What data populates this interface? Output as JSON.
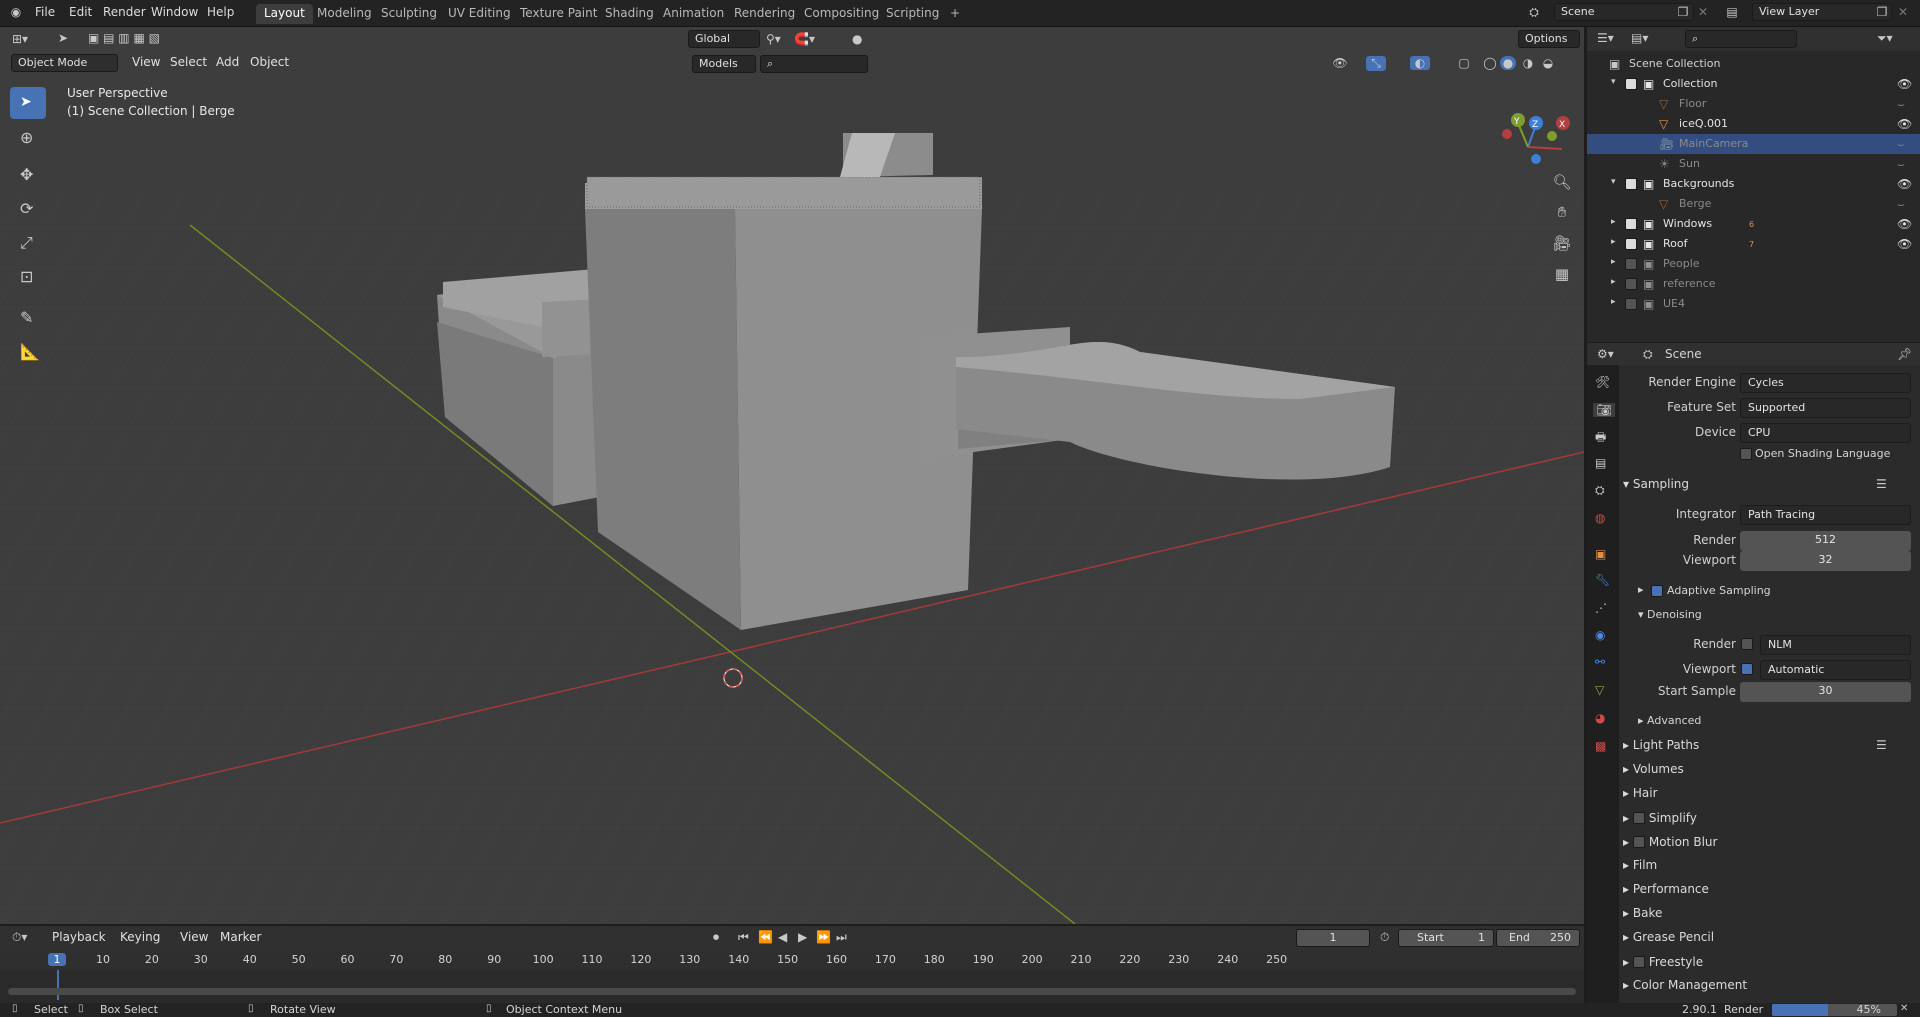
{
  "menubar": {
    "items": [
      "File",
      "Edit",
      "Render",
      "Window",
      "Help"
    ],
    "workspaces": [
      "Layout",
      "Modeling",
      "Sculpting",
      "UV Editing",
      "Texture Paint",
      "Shading",
      "Animation",
      "Rendering",
      "Compositing",
      "Scripting"
    ],
    "active_workspace": "Layout",
    "add_tab": "+",
    "scene_name": "Scene",
    "view_layer_name": "View Layer"
  },
  "viewport_header": {
    "mode": "Object Mode",
    "menus": [
      "View",
      "Select",
      "Add",
      "Object"
    ],
    "orientation": "Global",
    "collection_filter": "Models",
    "options": "Options"
  },
  "viewport": {
    "perspective_label": "User Perspective",
    "context_label": "(1) Scene Collection | Berge",
    "gizmo_axes": [
      "X",
      "Y",
      "Z"
    ]
  },
  "outliner": {
    "root": "Scene Collection",
    "rows": [
      {
        "name": "Collection",
        "type": "collection",
        "checked": true,
        "visible": true,
        "depth": 1
      },
      {
        "name": "Floor",
        "type": "object",
        "dim": true,
        "visible": false,
        "depth": 2
      },
      {
        "name": "iceQ.001",
        "type": "object",
        "dim": false,
        "visible": true,
        "depth": 2
      },
      {
        "name": "MainCamera",
        "type": "camera",
        "dim": true,
        "visible": false,
        "selected": true,
        "depth": 2
      },
      {
        "name": "Sun",
        "type": "light",
        "dim": true,
        "visible": false,
        "depth": 2
      },
      {
        "name": "Backgrounds",
        "type": "collection",
        "checked": true,
        "visible": true,
        "depth": 1
      },
      {
        "name": "Berge",
        "type": "object",
        "dim": true,
        "visible": false,
        "depth": 2
      },
      {
        "name": "Windows",
        "type": "collection",
        "checked": true,
        "visible": true,
        "depth": 1,
        "badge": "6"
      },
      {
        "name": "Roof",
        "type": "collection",
        "checked": true,
        "visible": true,
        "depth": 1,
        "badge": "7"
      },
      {
        "name": "People",
        "type": "collection",
        "checked": false,
        "dim": true,
        "depth": 1
      },
      {
        "name": "reference",
        "type": "collection",
        "checked": false,
        "dim": true,
        "depth": 1
      },
      {
        "name": "UE4",
        "type": "collection",
        "checked": false,
        "dim": true,
        "depth": 1
      }
    ]
  },
  "properties": {
    "context": "Scene",
    "render_engine_label": "Render Engine",
    "render_engine": "Cycles",
    "feature_set_label": "Feature Set",
    "feature_set": "Supported",
    "device_label": "Device",
    "device": "CPU",
    "osl_label": "Open Shading Language",
    "sampling": {
      "title": "Sampling",
      "integrator_label": "Integrator",
      "integrator": "Path Tracing",
      "render_label": "Render",
      "render": "512",
      "viewport_label": "Viewport",
      "viewport": "32",
      "adaptive_label": "Adaptive Sampling",
      "denoising": {
        "title": "Denoising",
        "render_label": "Render",
        "render_value": "NLM",
        "viewport_label": "Viewport",
        "viewport_value": "Automatic",
        "start_sample_label": "Start Sample",
        "start_sample": "30"
      },
      "advanced_label": "Advanced"
    },
    "panels": [
      "Light Paths",
      "Volumes",
      "Hair",
      "Simplify",
      "Motion Blur",
      "Film",
      "Performance",
      "Bake",
      "Grease Pencil",
      "Freestyle",
      "Color Management"
    ]
  },
  "timeline": {
    "menus": [
      "Playback",
      "Keying",
      "View",
      "Marker"
    ],
    "current_frame": "1",
    "start_label": "Start",
    "start": "1",
    "end_label": "End",
    "end": "250",
    "ticks": [
      "1",
      "10",
      "20",
      "30",
      "40",
      "50",
      "60",
      "70",
      "80",
      "90",
      "100",
      "110",
      "120",
      "130",
      "140",
      "150",
      "160",
      "170",
      "180",
      "190",
      "200",
      "210",
      "220",
      "230",
      "240",
      "250"
    ]
  },
  "statusbar": {
    "select": "Select",
    "box_select": "Box Select",
    "rotate_view": "Rotate View",
    "context_menu": "Object Context Menu",
    "version": "2.90.1",
    "render_label": "Render",
    "render_progress": "45%",
    "render_progress_fraction": 0.45
  },
  "colors": {
    "accent": "#4772b3",
    "x_axis": "#b53e3e",
    "y_axis": "#7f9e2d",
    "z_axis": "#3b7fd8",
    "collection_icon": "#e6e6e6",
    "mesh_icon": "#e38f4a"
  }
}
